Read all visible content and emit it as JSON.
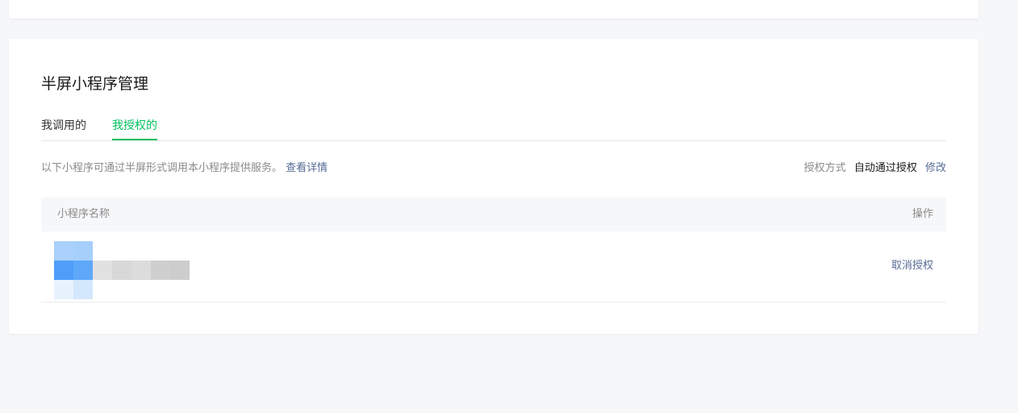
{
  "section": {
    "title": "半屏小程序管理",
    "tabs": [
      {
        "label": "我调用的",
        "active": false
      },
      {
        "label": "我授权的",
        "active": true
      }
    ],
    "description": "以下小程序可通过半屏形式调用本小程序提供服务。",
    "details_link": "查看详情",
    "auth_mode": {
      "label": "授权方式",
      "value": "自动通过授权",
      "edit_label": "修改"
    }
  },
  "table": {
    "columns": [
      "小程序名称",
      "操作"
    ],
    "rows": [
      {
        "action": "取消授权"
      }
    ]
  },
  "colors": {
    "accent_green": "#07c160",
    "link_blue": "#576b95",
    "page_bg": "#f6f7f9"
  }
}
